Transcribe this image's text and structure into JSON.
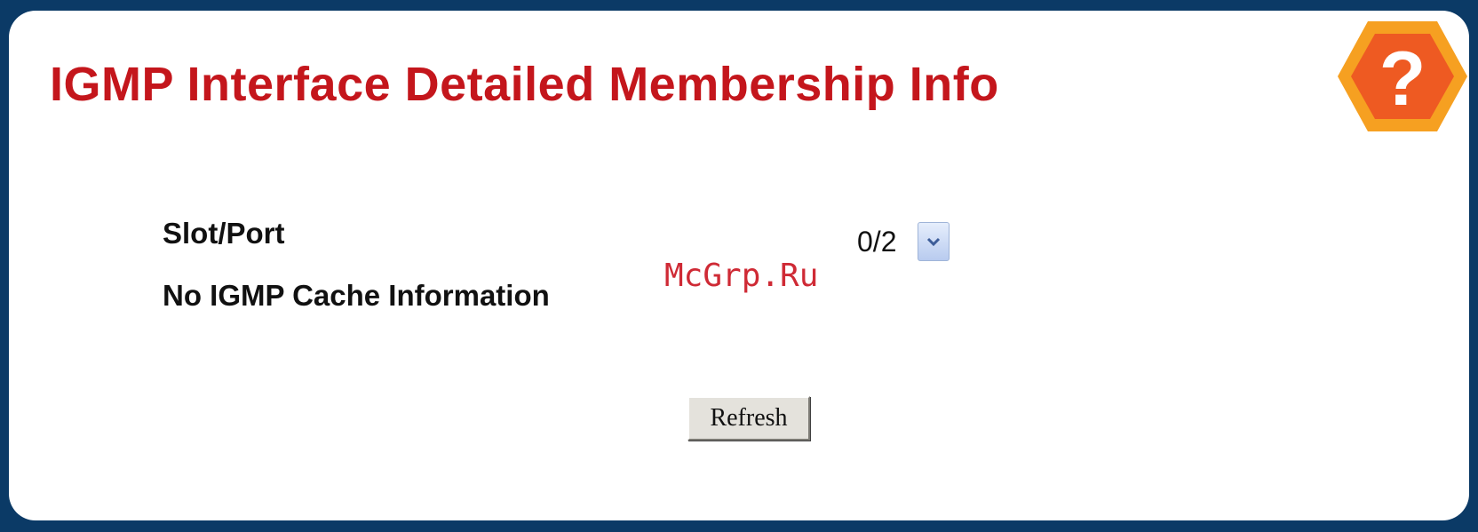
{
  "page": {
    "title": "IGMP Interface Detailed Membership Info",
    "title_color": "#c4161c",
    "frame_color": "#0b3a66"
  },
  "help": {
    "icon": "help-icon",
    "glyph": "?",
    "colors": {
      "outer": "#f6a021",
      "inner": "#ee5a22",
      "glyph": "#ffffff"
    }
  },
  "form": {
    "slot_port": {
      "label": "Slot/Port",
      "value": "0/2",
      "icon": "chevron-down-icon"
    },
    "status_message": "No IGMP Cache Information"
  },
  "actions": {
    "refresh_label": "Refresh"
  },
  "watermark": {
    "text": "McGrp.Ru",
    "color": "#cf2a35"
  }
}
